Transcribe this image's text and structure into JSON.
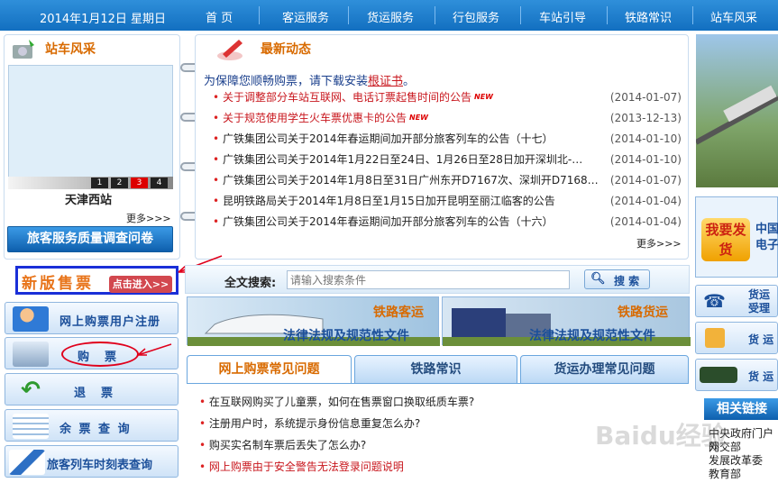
{
  "topbar": {
    "date": "2014年1月12日 星期日",
    "nav": [
      "首 页",
      "客运服务",
      "货运服务",
      "行包服务",
      "车站引导",
      "铁路常识",
      "站车风采"
    ]
  },
  "station": {
    "title": "站车风采",
    "name": "天津西站",
    "pages": [
      "1",
      "2",
      "3",
      "4"
    ],
    "more": "更多>>>",
    "survey_button": "旅客服务质量调查问卷"
  },
  "news": {
    "title": "最新动态",
    "cert_prefix": "为保障您顺畅购票，请下载安装",
    "cert_link": "根证书",
    "cert_suffix": "。",
    "items": [
      {
        "text": "关于调整部分车站互联网、电话订票起售时间的公告",
        "date": "(2014-01-07)",
        "hot": true,
        "new": "NEW"
      },
      {
        "text": "关于规范使用学生火车票优惠卡的公告",
        "date": "(2013-12-13)",
        "hot": true,
        "new": "NEW"
      },
      {
        "text": "广铁集团公司关于2014年春运期间加开部分旅客列车的公告（十七）",
        "date": "(2014-01-10)",
        "hot": false,
        "new": ""
      },
      {
        "text": "广铁集团公司关于2014年1月22日至24日、1月26日至28日加开深圳北-…",
        "date": "(2014-01-10)",
        "hot": false,
        "new": ""
      },
      {
        "text": "广铁集团公司关于2014年1月8日至31日广州东开D7167次、深圳开D7168…",
        "date": "(2014-01-07)",
        "hot": false,
        "new": ""
      },
      {
        "text": "昆明铁路局关于2014年1月8日至1月15日加开昆明至丽江临客的公告",
        "date": "(2014-01-04)",
        "hot": false,
        "new": ""
      },
      {
        "text": "广铁集团公司关于2014年春运期间加开部分旅客列车的公告（十六）",
        "date": "(2014-01-04)",
        "hot": false,
        "new": ""
      }
    ],
    "more": "更多>>>"
  },
  "left_menu": {
    "new_ticket": "新版售票",
    "enter": "点击进入>>",
    "register": "网上购票用户注册",
    "buy": "购　票",
    "refund": "退　票",
    "remaining": "余 票 查 询",
    "timetable": "旅客列车时刻表查询"
  },
  "search": {
    "label": "全文搜索:",
    "placeholder": "请输入搜索条件",
    "button": "搜 索"
  },
  "banners": {
    "passenger_title": "铁路客运",
    "passenger_sub": "法律法规及规范性文件",
    "freight_title": "铁路货运",
    "freight_sub": "法律法规及规范性文件"
  },
  "tabs": [
    "网上购票常见问题",
    "铁路常识",
    "货运办理常见问题"
  ],
  "faq": [
    "在互联网购买了儿童票，如何在售票窗口换取纸质车票?",
    "注册用户时，系统提示身份信息重复怎么办?",
    "购买实名制车票后丢失了怎么办?",
    "网上购票由于安全警告无法登录问题说明"
  ],
  "right": {
    "ship_button": "我要发货",
    "ship_text": "中国\n电子",
    "freight1": "货运\n受理",
    "freight2": "货 运",
    "freight3": "货 运",
    "links_title": "相关链接",
    "links": [
      "中央政府门户网",
      "外交部",
      "发展改革委",
      "教育部"
    ]
  },
  "watermark": "Baidu经验",
  "colors": {
    "nav_blue": "#1e7fcf",
    "accent_orange": "#d86a00",
    "link_red": "#c8161d",
    "annotation_red": "#e0001b",
    "highlight_blue": "#1a2fd8"
  }
}
